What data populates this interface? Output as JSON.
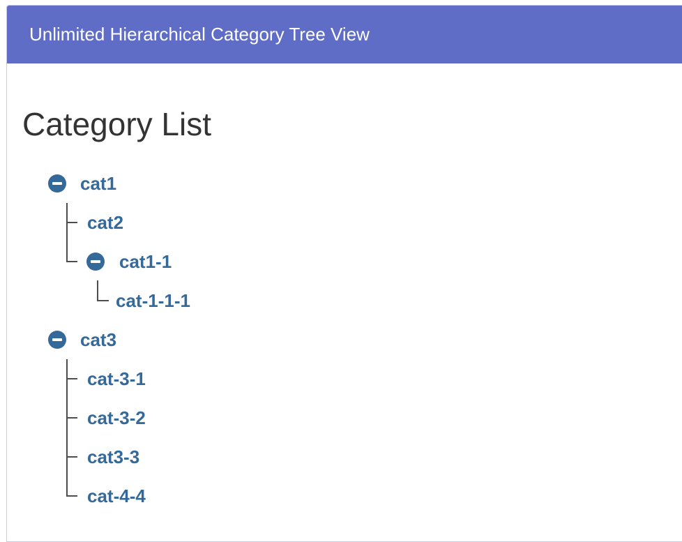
{
  "colors": {
    "accent": "#5f6dc7",
    "link": "#34699a"
  },
  "header": {
    "title": "Unlimited Hierarchical Category Tree View"
  },
  "main": {
    "page_title": "Category List"
  },
  "tree": {
    "toggle_icon": "minus-circle-icon",
    "nodes": [
      {
        "label": "cat1",
        "expanded": true
      },
      {
        "label": "cat2"
      },
      {
        "label": "cat1-1",
        "expanded": true
      },
      {
        "label": "cat-1-1-1"
      },
      {
        "label": "cat3",
        "expanded": true
      },
      {
        "label": "cat-3-1"
      },
      {
        "label": "cat-3-2"
      },
      {
        "label": "cat3-3"
      },
      {
        "label": "cat-4-4"
      }
    ]
  }
}
